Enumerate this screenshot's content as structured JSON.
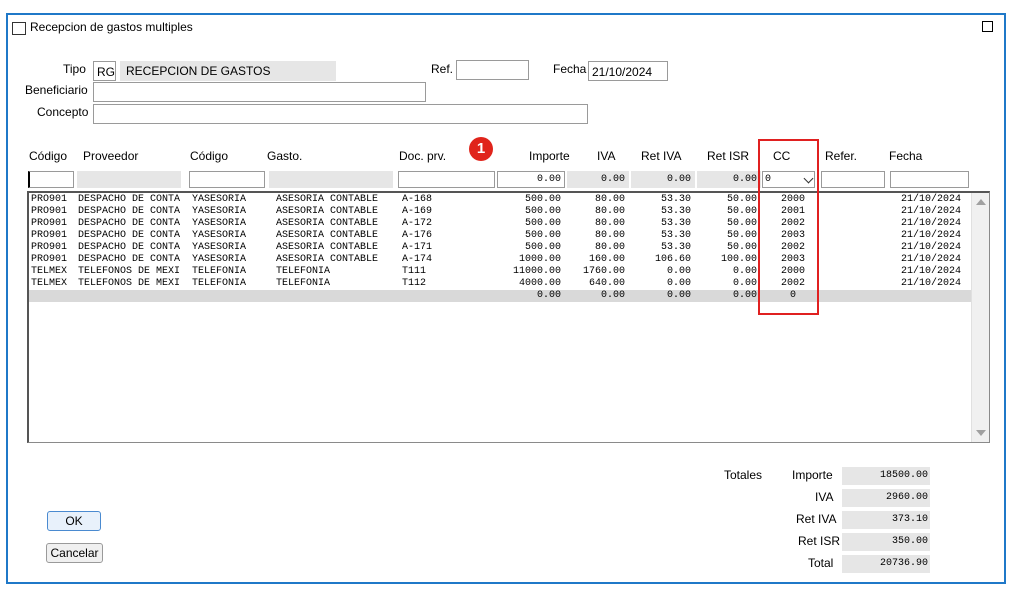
{
  "window": {
    "title": "Recepcion de gastos multiples"
  },
  "form": {
    "tipo_label": "Tipo",
    "tipo_code": "RG",
    "tipo_desc": "RECEPCION DE GASTOS",
    "ref_label": "Ref.",
    "ref_value": "",
    "fecha_label": "Fecha",
    "fecha_value": "21/10/2024",
    "beneficiario_label": "Beneficiario",
    "beneficiario_value": "",
    "concepto_label": "Concepto",
    "concepto_value": ""
  },
  "annotation": {
    "badge": "1"
  },
  "columns": {
    "codigo": "Código",
    "proveedor": "Proveedor",
    "codigo2": "Código",
    "gasto": "Gasto.",
    "docprv": "Doc. prv.",
    "importe": "Importe",
    "iva": "IVA",
    "retiva": "Ret IVA",
    "retisr": "Ret ISR",
    "cc": "CC",
    "refer": "Refer.",
    "fecha": "Fecha"
  },
  "entry": {
    "importe": "0.00",
    "iva": "0.00",
    "retiva": "0.00",
    "retisr": "0.00",
    "cc": "0"
  },
  "rows": [
    {
      "codigo": "PRO901",
      "proveedor": "DESPACHO DE CONTA",
      "codigo2": "YASESORIA",
      "gasto": "ASESORIA CONTABLE",
      "doc": "A-168",
      "importe": "500.00",
      "iva": "80.00",
      "retiva": "53.30",
      "retisr": "50.00",
      "cc": "2000",
      "fecha": "21/10/2024"
    },
    {
      "codigo": "PRO901",
      "proveedor": "DESPACHO DE CONTA",
      "codigo2": "YASESORIA",
      "gasto": "ASESORIA CONTABLE",
      "doc": "A-169",
      "importe": "500.00",
      "iva": "80.00",
      "retiva": "53.30",
      "retisr": "50.00",
      "cc": "2001",
      "fecha": "21/10/2024"
    },
    {
      "codigo": "PRO901",
      "proveedor": "DESPACHO DE CONTA",
      "codigo2": "YASESORIA",
      "gasto": "ASESORIA CONTABLE",
      "doc": "A-172",
      "importe": "500.00",
      "iva": "80.00",
      "retiva": "53.30",
      "retisr": "50.00",
      "cc": "2002",
      "fecha": "21/10/2024"
    },
    {
      "codigo": "PRO901",
      "proveedor": "DESPACHO DE CONTA",
      "codigo2": "YASESORIA",
      "gasto": "ASESORIA CONTABLE",
      "doc": "A-176",
      "importe": "500.00",
      "iva": "80.00",
      "retiva": "53.30",
      "retisr": "50.00",
      "cc": "2003",
      "fecha": "21/10/2024"
    },
    {
      "codigo": "PRO901",
      "proveedor": "DESPACHO DE CONTA",
      "codigo2": "YASESORIA",
      "gasto": "ASESORIA CONTABLE",
      "doc": "A-171",
      "importe": "500.00",
      "iva": "80.00",
      "retiva": "53.30",
      "retisr": "50.00",
      "cc": "2002",
      "fecha": "21/10/2024"
    },
    {
      "codigo": "PRO901",
      "proveedor": "DESPACHO DE CONTA",
      "codigo2": "YASESORIA",
      "gasto": "ASESORIA CONTABLE",
      "doc": "A-174",
      "importe": "1000.00",
      "iva": "160.00",
      "retiva": "106.60",
      "retisr": "100.00",
      "cc": "2003",
      "fecha": "21/10/2024"
    },
    {
      "codigo": "TELMEX",
      "proveedor": "TELEFONOS DE MEXI",
      "codigo2": "TELEFONIA",
      "gasto": "TELEFONIA",
      "doc": "T111",
      "importe": "11000.00",
      "iva": "1760.00",
      "retiva": "0.00",
      "retisr": "0.00",
      "cc": "2000",
      "fecha": "21/10/2024"
    },
    {
      "codigo": "TELMEX",
      "proveedor": "TELEFONOS DE MEXI",
      "codigo2": "TELEFONIA",
      "gasto": "TELEFONIA",
      "doc": "T112",
      "importe": "4000.00",
      "iva": "640.00",
      "retiva": "0.00",
      "retisr": "0.00",
      "cc": "2002",
      "fecha": "21/10/2024"
    }
  ],
  "sum_row": {
    "importe": "0.00",
    "iva": "0.00",
    "retiva": "0.00",
    "retisr": "0.00",
    "cc": "0"
  },
  "totals": {
    "label": "Totales",
    "importe_label": "Importe",
    "importe": "18500.00",
    "iva_label": "IVA",
    "iva": "2960.00",
    "retiva_label": "Ret IVA",
    "retiva": "373.10",
    "retisr_label": "Ret ISR",
    "retisr": "350.00",
    "total_label": "Total",
    "total": "20736.90"
  },
  "buttons": {
    "ok": "OK",
    "cancel": "Cancelar"
  }
}
